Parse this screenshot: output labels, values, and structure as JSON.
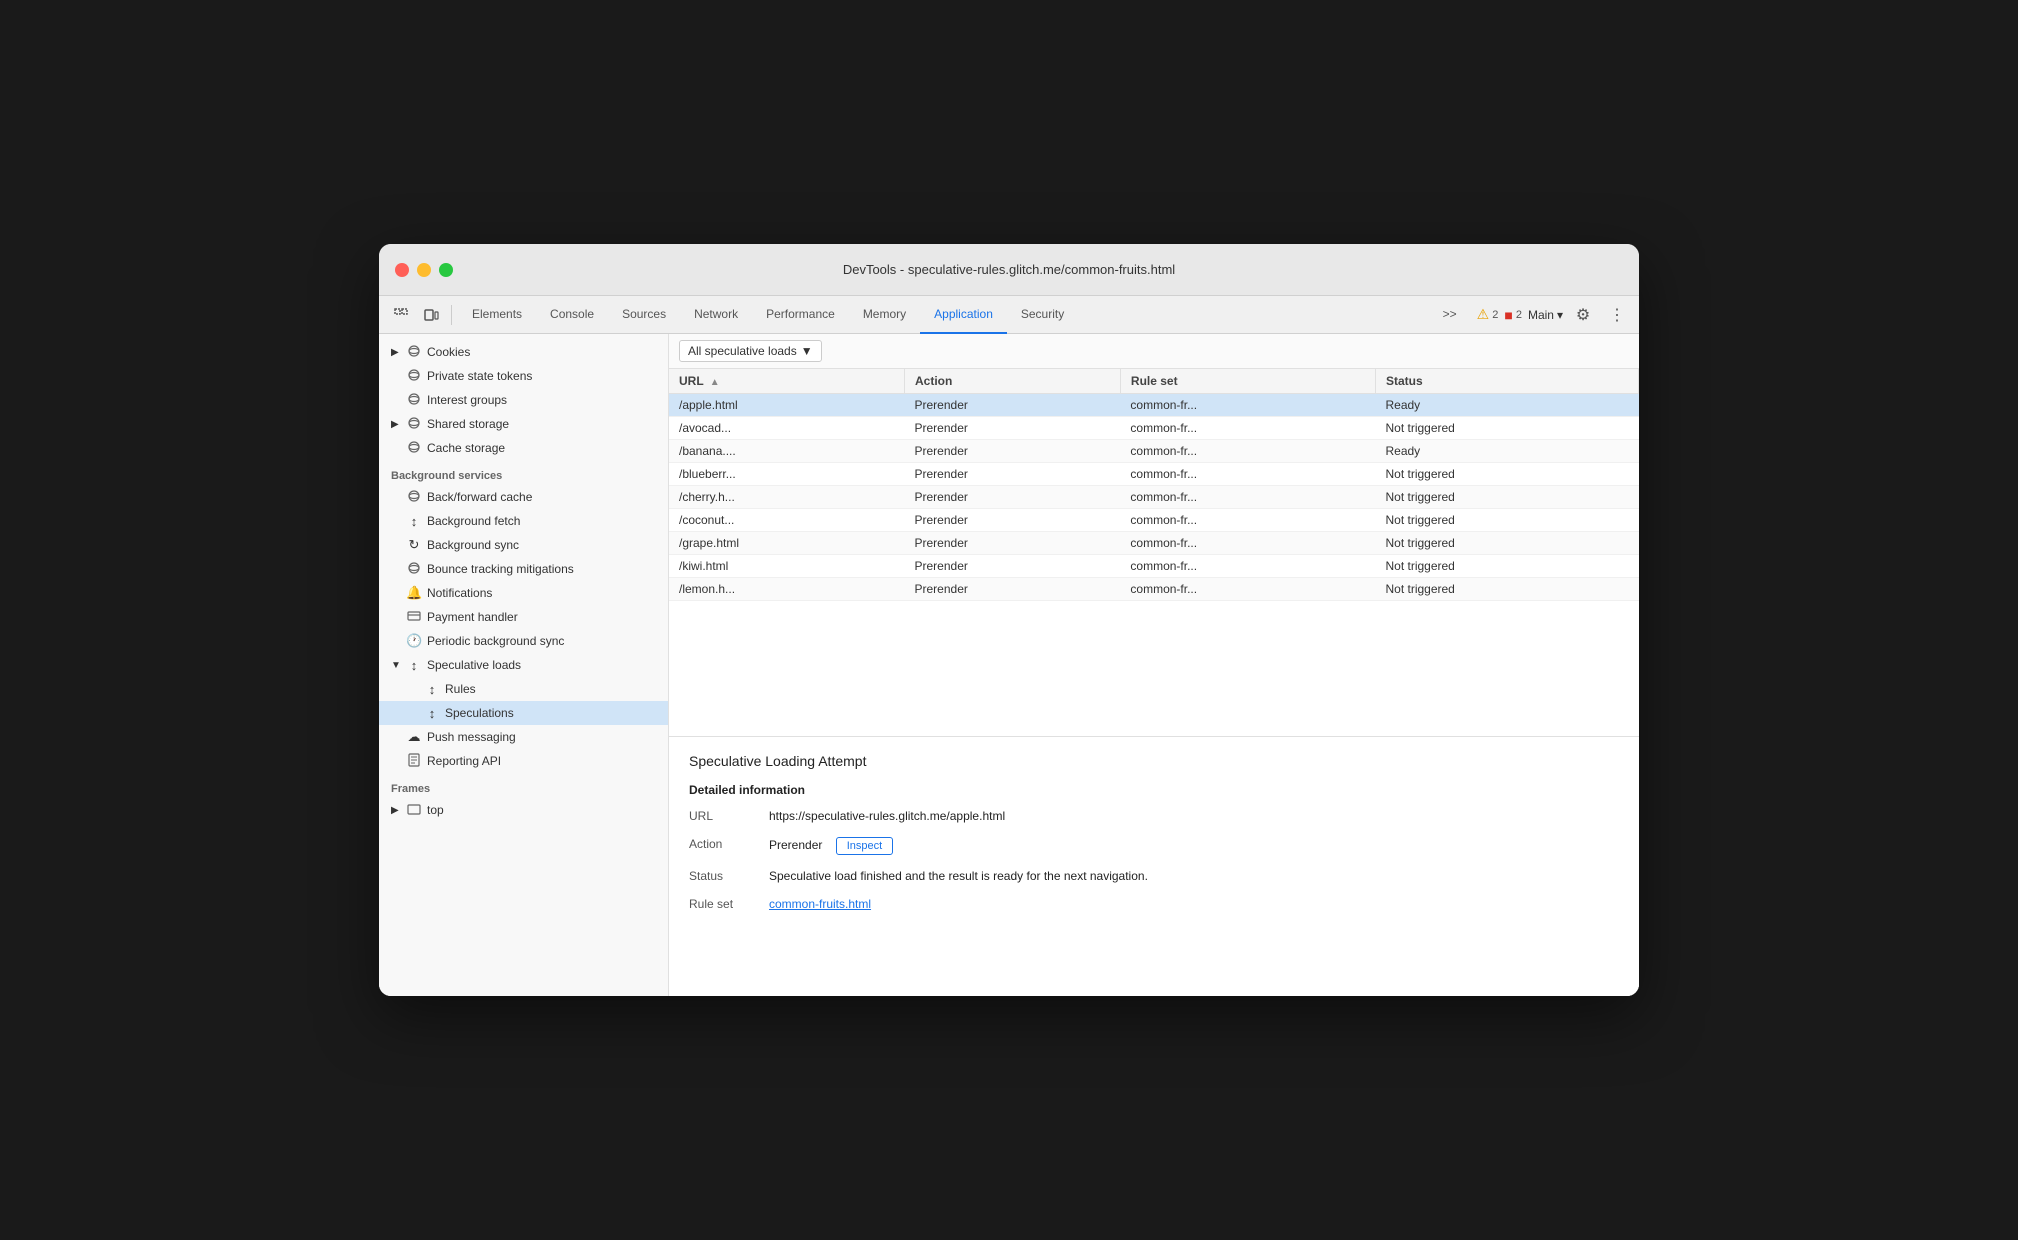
{
  "window": {
    "title": "DevTools - speculative-rules.glitch.me/common-fruits.html"
  },
  "toolbar": {
    "tabs": [
      {
        "label": "Elements",
        "active": false
      },
      {
        "label": "Console",
        "active": false
      },
      {
        "label": "Sources",
        "active": false
      },
      {
        "label": "Network",
        "active": false
      },
      {
        "label": "Performance",
        "active": false
      },
      {
        "label": "Memory",
        "active": false
      },
      {
        "label": "Application",
        "active": true
      },
      {
        "label": "Security",
        "active": false
      }
    ],
    "more_label": ">>",
    "warning_count": "2",
    "error_count": "2",
    "main_label": "Main",
    "settings_icon": "⚙",
    "more_icon": "⋮"
  },
  "sidebar": {
    "sections": [
      {
        "items": [
          {
            "label": "Cookies",
            "icon": "🗄",
            "arrow": "▶",
            "indent": 0
          },
          {
            "label": "Private state tokens",
            "icon": "🗄",
            "indent": 0
          },
          {
            "label": "Interest groups",
            "icon": "🗄",
            "indent": 0
          },
          {
            "label": "Shared storage",
            "icon": "🗄",
            "arrow": "▶",
            "indent": 0
          },
          {
            "label": "Cache storage",
            "icon": "🗄",
            "indent": 0
          }
        ]
      },
      {
        "header": "Background services",
        "items": [
          {
            "label": "Back/forward cache",
            "icon": "🗄",
            "indent": 0
          },
          {
            "label": "Background fetch",
            "icon": "↕",
            "indent": 0
          },
          {
            "label": "Background sync",
            "icon": "↻",
            "indent": 0
          },
          {
            "label": "Bounce tracking mitigations",
            "icon": "🗄",
            "indent": 0
          },
          {
            "label": "Notifications",
            "icon": "🔔",
            "indent": 0
          },
          {
            "label": "Payment handler",
            "icon": "🃏",
            "indent": 0
          },
          {
            "label": "Periodic background sync",
            "icon": "🕐",
            "indent": 0
          },
          {
            "label": "Speculative loads",
            "icon": "↕",
            "arrow": "▼",
            "indent": 0,
            "expanded": true
          },
          {
            "label": "Rules",
            "icon": "↕",
            "indent": 1
          },
          {
            "label": "Speculations",
            "icon": "↕",
            "indent": 1,
            "active": true
          },
          {
            "label": "Push messaging",
            "icon": "☁",
            "indent": 0
          },
          {
            "label": "Reporting API",
            "icon": "📄",
            "indent": 0
          }
        ]
      },
      {
        "header": "Frames",
        "items": [
          {
            "label": "top",
            "icon": "▭",
            "arrow": "▶",
            "indent": 0
          }
        ]
      }
    ]
  },
  "main": {
    "filter": {
      "label": "All speculative loads",
      "dropdown_arrow": "▼"
    },
    "table": {
      "columns": [
        {
          "label": "URL",
          "sort_arrow": "▲"
        },
        {
          "label": "Action"
        },
        {
          "label": "Rule set"
        },
        {
          "label": "Status"
        }
      ],
      "rows": [
        {
          "url": "/apple.html",
          "action": "Prerender",
          "rule_set": "common-fr...",
          "status": "Ready",
          "selected": true
        },
        {
          "url": "/avocad...",
          "action": "Prerender",
          "rule_set": "common-fr...",
          "status": "Not triggered"
        },
        {
          "url": "/banana....",
          "action": "Prerender",
          "rule_set": "common-fr...",
          "status": "Ready"
        },
        {
          "url": "/blueberr...",
          "action": "Prerender",
          "rule_set": "common-fr...",
          "status": "Not triggered"
        },
        {
          "url": "/cherry.h...",
          "action": "Prerender",
          "rule_set": "common-fr...",
          "status": "Not triggered"
        },
        {
          "url": "/coconut...",
          "action": "Prerender",
          "rule_set": "common-fr...",
          "status": "Not triggered"
        },
        {
          "url": "/grape.html",
          "action": "Prerender",
          "rule_set": "common-fr...",
          "status": "Not triggered"
        },
        {
          "url": "/kiwi.html",
          "action": "Prerender",
          "rule_set": "common-fr...",
          "status": "Not triggered"
        },
        {
          "url": "/lemon.h...",
          "action": "Prerender",
          "rule_set": "common-fr...",
          "status": "Not triggered"
        }
      ]
    },
    "detail": {
      "title": "Speculative Loading Attempt",
      "section_title": "Detailed information",
      "fields": [
        {
          "label": "URL",
          "value": "https://speculative-rules.glitch.me/apple.html"
        },
        {
          "label": "Action",
          "value": "Prerender",
          "has_inspect": true,
          "inspect_label": "Inspect"
        },
        {
          "label": "Status",
          "value": "Speculative load finished and the result is ready for the next navigation."
        },
        {
          "label": "Rule set",
          "value": "common-fruits.html",
          "is_link": true
        }
      ]
    }
  }
}
